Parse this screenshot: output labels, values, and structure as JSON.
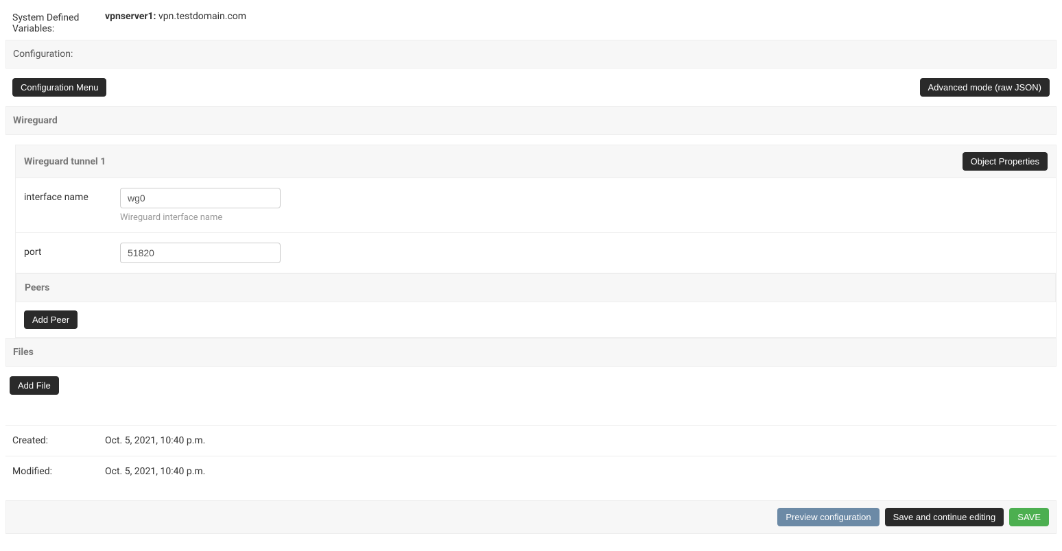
{
  "sysvars": {
    "label": "System Defined Variables:",
    "varname": "vpnserver1:",
    "varvalue": "vpn.testdomain.com"
  },
  "configuration": {
    "header": "Configuration:",
    "menu_button": "Configuration Menu",
    "advanced_button": "Advanced mode (raw JSON)"
  },
  "wireguard": {
    "section_title": "Wireguard",
    "tunnel": {
      "title": "Wireguard tunnel 1",
      "object_props_button": "Object Properties",
      "interface_name": {
        "label": "interface name",
        "value": "wg0",
        "help": "Wireguard interface name"
      },
      "port": {
        "label": "port",
        "value": "51820"
      }
    },
    "peers": {
      "title": "Peers",
      "add_button": "Add Peer"
    }
  },
  "files": {
    "title": "Files",
    "add_button": "Add File"
  },
  "meta": {
    "created_label": "Created:",
    "created_value": "Oct. 5, 2021, 10:40 p.m.",
    "modified_label": "Modified:",
    "modified_value": "Oct. 5, 2021, 10:40 p.m."
  },
  "footer": {
    "preview": "Preview configuration",
    "save_continue": "Save and continue editing",
    "save": "SAVE"
  }
}
